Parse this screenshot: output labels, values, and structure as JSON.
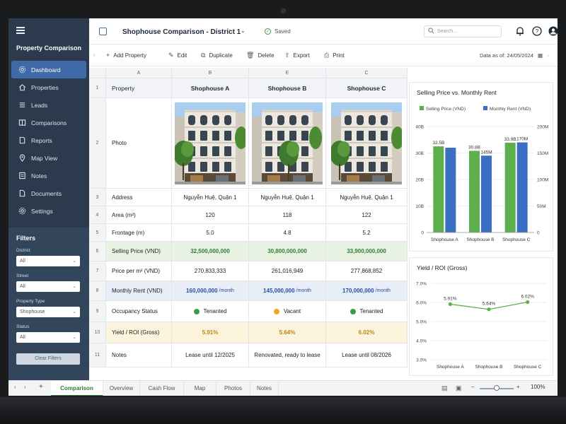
{
  "app": {
    "name": "Property Comparison",
    "doc_title": "Shophouse Comparison - District 1",
    "saved": "Saved",
    "search_placeholder": "Search..."
  },
  "sidebar": {
    "items": [
      {
        "label": "Dashboard",
        "icon": "gear-icon"
      },
      {
        "label": "Properties",
        "icon": "home-icon"
      },
      {
        "label": "Leads",
        "icon": "menu-icon"
      },
      {
        "label": "Comparisons",
        "icon": "compare-icon"
      },
      {
        "label": "Reports",
        "icon": "report-icon"
      },
      {
        "label": "Map View",
        "icon": "map-icon"
      },
      {
        "label": "Notes",
        "icon": "note-icon"
      },
      {
        "label": "Documents",
        "icon": "document-icon"
      },
      {
        "label": "Settings",
        "icon": "gear-icon"
      }
    ],
    "filters": {
      "title": "Filters",
      "district": {
        "label": "District",
        "value": "All"
      },
      "street": {
        "label": "Street",
        "value": "All"
      },
      "property_type": {
        "label": "Property Type",
        "value": "Shophouse"
      },
      "status": {
        "label": "Status",
        "value": "All"
      },
      "clear": "Clear Filters"
    }
  },
  "toolbar": {
    "add": "Add Property",
    "edit": "Edit",
    "duplicate": "Duplicate",
    "delete": "Delete",
    "export": "Export",
    "print": "Print",
    "data_as_of_label": "Data as of:",
    "data_as_of": "24/05/2024"
  },
  "sheet": {
    "columns": [
      "A",
      "B",
      "E",
      "C"
    ],
    "headers": [
      "Property",
      "Shophouse A",
      "Shophouse B",
      "Shophouse C"
    ],
    "rows": {
      "photo": "Photo",
      "address": {
        "label": "Address",
        "values": [
          "Nguyễn Huệ, Quận 1",
          "Nguyễn Huệ, Quận 1",
          "Nguyễn Huệ, Quận 1"
        ]
      },
      "area": {
        "label": "Area (m²)",
        "values": [
          "120",
          "118",
          "122"
        ]
      },
      "frontage": {
        "label": "Frontage (m)",
        "values": [
          "5.0",
          "4.8",
          "5.2"
        ]
      },
      "price": {
        "label": "Selling Price (VND)",
        "values": [
          "32,500,000,000",
          "30,800,000,000",
          "33,900,000,000"
        ]
      },
      "ppm": {
        "label": "Price per m² (VND)",
        "values": [
          "270,833,333",
          "261,016,949",
          "277,868,852"
        ]
      },
      "rent": {
        "label": "Monthly Rent (VND)",
        "values": [
          "160,000,000",
          "145,000,000",
          "170,000,000"
        ],
        "unit": "/month"
      },
      "occupancy": {
        "label": "Occupancy Status",
        "values": [
          "Tenanted",
          "Vacant",
          "Tenanted"
        ],
        "colors": [
          "#3a9a4a",
          "#f2a81d",
          "#3a9a4a"
        ]
      },
      "yield": {
        "label": "Yield / ROI (Gross)",
        "values": [
          "5.91%",
          "5.64%",
          "6.02%"
        ]
      },
      "notes": {
        "label": "Notes",
        "values": [
          "Lease until 12/2025",
          "Renovated, ready to lease",
          "Lease until 08/2026"
        ]
      }
    }
  },
  "tabs": [
    "Comparison",
    "Overview",
    "Cash Flow",
    "Map",
    "Photos",
    "Notes"
  ],
  "zoom": "100%",
  "colors": {
    "sidebar": "#2b3a4c",
    "accent": "#3f6aa6",
    "green": "#5fae4e",
    "blue": "#3b6fc4"
  },
  "chart_data": [
    {
      "type": "bar",
      "title": "Selling Price vs. Monthly Rent",
      "categories": [
        "Shophouse A",
        "Shophouse B",
        "Shophouse C"
      ],
      "series": [
        {
          "name": "Selling Price (VND)",
          "values": [
            32.5,
            30.8,
            33.9
          ],
          "labels": [
            "32.5B",
            "30.8B",
            "33.9B"
          ],
          "axis": "left"
        },
        {
          "name": "Monthly Rent (VND)",
          "values": [
            160,
            145,
            170
          ],
          "labels": [
            "",
            "145M",
            "170M"
          ],
          "axis": "right"
        }
      ],
      "left_ticks": [
        "0",
        "10B",
        "20B",
        "30B",
        "40B"
      ],
      "right_ticks": [
        "0",
        "50M",
        "100M",
        "150M",
        "200M"
      ],
      "ylim_left": [
        0,
        40
      ],
      "ylim_right": [
        0,
        200
      ],
      "legend": "top"
    },
    {
      "type": "line",
      "title": "Yield / ROI (Gross)",
      "categories": [
        "Shophouse A",
        "Shophouse B",
        "Shophouse C"
      ],
      "values": [
        5.91,
        5.64,
        6.02
      ],
      "labels": [
        "5.91%",
        "5.64%",
        "6.02%"
      ],
      "y_ticks": [
        "3.0%",
        "4.0%",
        "5.0%",
        "6.0%",
        "7.0%"
      ],
      "ylim": [
        3.0,
        7.0
      ]
    }
  ]
}
